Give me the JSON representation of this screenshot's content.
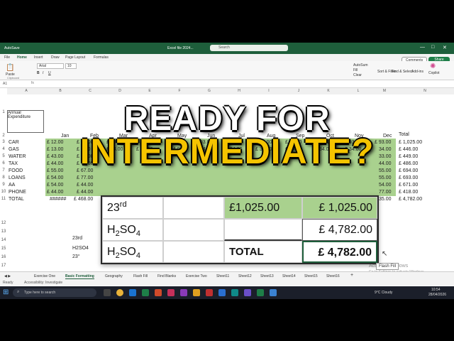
{
  "window": {
    "autosave": "AutoSave",
    "file_name": "Excel file 2024...",
    "search": "Search"
  },
  "tabs": [
    "File",
    "Home",
    "Insert",
    "Draw",
    "Page Layout",
    "Formulas"
  ],
  "ribbon": {
    "paste": "Paste",
    "clipboard": "Clipboard",
    "font_name": "Arial",
    "font_size": "10",
    "autosum": "AutoSum",
    "fill": "Fill",
    "clear": "Clear",
    "sort": "Sort & Filter",
    "find": "Find & Select",
    "addins": "Add-ins",
    "copilot": "Copilot",
    "comments": "Comments",
    "share": "Share"
  },
  "headline": {
    "line1": "READY FOR",
    "line2": "INTERMEDIATE?"
  },
  "sheet": {
    "columns": [
      "A",
      "B",
      "C",
      "D",
      "E",
      "F",
      "G",
      "H",
      "I",
      "J",
      "K",
      "L",
      "M",
      "N"
    ],
    "a1": "Annual Expenditure",
    "months": [
      "Jan",
      "Feb",
      "Mar",
      "Apr",
      "May",
      "Jun",
      "Jul",
      "Aug",
      "Sep",
      "Oct",
      "Nov",
      "Dec"
    ],
    "total_header": "Total",
    "rows": [
      {
        "n": "3",
        "label": "CAR",
        "jan": "£ 12.00",
        "feb": "£ 77.00",
        "mar": "£ 93.00",
        "apr": "£ 93.00",
        "may": "£ 93.00",
        "jun": "£ 93.00",
        "jul": "£ 93.00",
        "aug": "£ 93.00",
        "sep": "£ 93.00",
        "oct": "£ 93.00",
        "nov": "£ 93.00",
        "dec": "£ 93.00",
        "total": "£ 1,025.00"
      },
      {
        "n": "4",
        "label": "GAS",
        "jan": "£ 13.00",
        "feb": "£ 7.00",
        "mar": "£ 34.00",
        "apr": "£ 34.00",
        "may": "£ 34.00",
        "jun": "£ 34.00",
        "jul": "£ 34.00",
        "aug": "£ 34.00",
        "sep": "£ 34.00",
        "oct": "£ 34.00",
        "nov": "£ 34.00",
        "dec": "34.00",
        "total": "£ 446.00"
      },
      {
        "n": "5",
        "label": "WATER",
        "jan": "£ 43.00",
        "feb": "£ 76.00",
        "dec": "33.00",
        "total": "£ 449.00"
      },
      {
        "n": "6",
        "label": "TAX",
        "jan": "£ 44.00",
        "feb": "£ 76.00",
        "dec": "44.00",
        "total": "£ 486.00"
      },
      {
        "n": "7",
        "label": "FOOD",
        "jan": "£ 55.00",
        "feb": "£ 67.00",
        "dec": "55.00",
        "total": "£ 694.00"
      },
      {
        "n": "8",
        "label": "LOANS",
        "jan": "£ 54.00",
        "feb": "£ 77.00",
        "dec": "55.00",
        "total": "£ 693.00"
      },
      {
        "n": "9",
        "label": "AA",
        "jan": "£ 54.00",
        "feb": "£ 44.00",
        "dec": "54.00",
        "total": "£ 671.00"
      },
      {
        "n": "10",
        "label": "PHONE",
        "jan": "£ 44.00",
        "feb": "£ 44.00",
        "dec": "77.00",
        "total": "£ 418.00"
      },
      {
        "n": "11",
        "label": "TOTAL",
        "jan": "######",
        "feb": "£ 468.00",
        "dec": "35.00",
        "total": "£ 4,782.00"
      }
    ],
    "extra_rows": [
      "12",
      "13",
      "14",
      "15",
      "16",
      "17"
    ],
    "a15": "23rd",
    "a16": "H2SO4",
    "a17": "23°"
  },
  "overlay": {
    "r1c1_base": "23",
    "r1c1_sup": "rd",
    "r1c3": "£1,025.00",
    "r1c4": "£ 1,025.00",
    "r2c1_base": "H",
    "r2c1_sub1": "2",
    "r2c1_mid": "SO",
    "r2c1_sub2": "4",
    "r2c4": "£ 4,782.00",
    "r3c1_base": "H",
    "r3c1_sub1": "2",
    "r3c1_mid": "SO",
    "r3c1_sub2": "4",
    "r3c3": "TOTAL",
    "r3c4": "£ 4,782.00"
  },
  "flash_fill": "Flash Fill",
  "activate": {
    "line1": "Activate Windows",
    "line2": "Go to Settings to activate Windows."
  },
  "sheet_tabs": [
    "Exercise One",
    "Basic Formatting",
    "Geography",
    "Flash Fill",
    "Find Blanks",
    "Exercise Two",
    "Sheet11",
    "Sheet12",
    "Sheet13",
    "Sheet14",
    "Sheet15",
    "Sheet16"
  ],
  "active_sheet": "Basic Formatting",
  "status": {
    "ready": "Ready",
    "accessibility": "Accessibility: Investigate"
  },
  "taskbar": {
    "search": "Type here to search",
    "weather": "9°C Cloudy",
    "time": "10:54",
    "date": "28/04/2026"
  },
  "colors": {
    "excel_green": "#1e5e3b",
    "cell_green": "#a9d18e",
    "headline_yellow": "#f5c400"
  }
}
